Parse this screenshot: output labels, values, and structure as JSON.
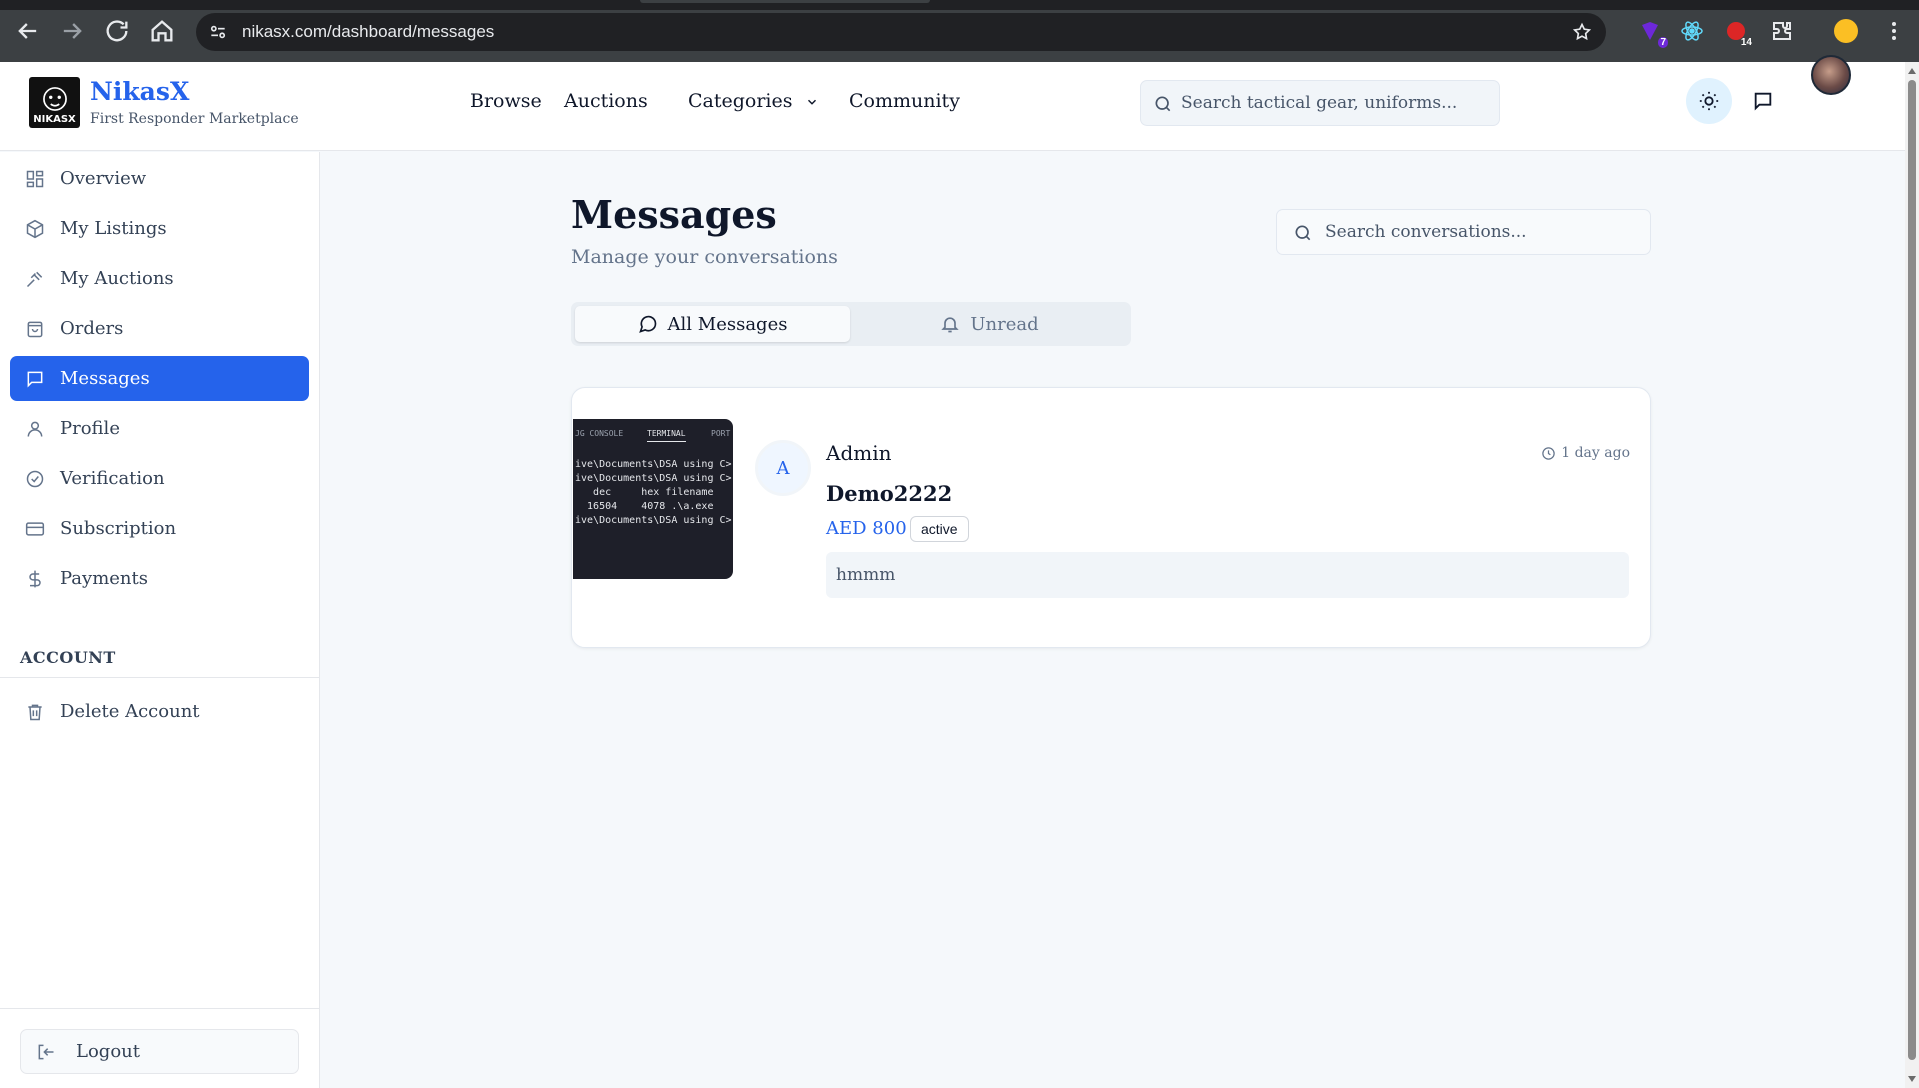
{
  "browser": {
    "url": "nikasx.com/dashboard/messages",
    "extension_badges": [
      "7",
      "14"
    ]
  },
  "header": {
    "brand_name": "NikasX",
    "brand_tagline": "First Responder Marketplace",
    "logo_text": "NIKASX",
    "nav": {
      "browse": "Browse",
      "auctions": "Auctions",
      "categories": "Categories",
      "community": "Community"
    },
    "search_placeholder": "Search tactical gear, uniforms..."
  },
  "sidebar": {
    "items": [
      {
        "label": "Overview",
        "icon": "grid-icon"
      },
      {
        "label": "My Listings",
        "icon": "package-icon"
      },
      {
        "label": "My Auctions",
        "icon": "gavel-icon"
      },
      {
        "label": "Orders",
        "icon": "shopping-bag-icon"
      },
      {
        "label": "Messages",
        "icon": "message-square-icon",
        "active": true
      },
      {
        "label": "Profile",
        "icon": "user-icon"
      },
      {
        "label": "Verification",
        "icon": "check-circle-icon"
      },
      {
        "label": "Subscription",
        "icon": "credit-card-icon"
      },
      {
        "label": "Payments",
        "icon": "dollar-icon"
      }
    ],
    "account_section": "ACCOUNT",
    "delete_account": "Delete Account",
    "logout": "Logout"
  },
  "main": {
    "title": "Messages",
    "subtitle": "Manage your conversations",
    "search_placeholder": "Search conversations...",
    "tabs": {
      "all": "All Messages",
      "unread": "Unread"
    },
    "conversations": [
      {
        "avatar_initial": "A",
        "sender": "Admin",
        "time": "1 day ago",
        "listing_title": "Demo2222",
        "price": "AED 800",
        "status": "active",
        "last_message": "hmmm",
        "thumbnail": {
          "tabs": [
            "JG CONSOLE",
            "TERMINAL",
            "PORT"
          ],
          "lines": [
            "ive\\Documents\\DSA using C>",
            "ive\\Documents\\DSA using C>",
            "   dec     hex filename",
            "  16504    4078 .\\a.exe",
            "ive\\Documents\\DSA using C>"
          ]
        }
      }
    ]
  },
  "colors": {
    "accent": "#2563eb",
    "background": "#f5f8fb",
    "text": "#0f172a",
    "muted": "#64748b"
  }
}
